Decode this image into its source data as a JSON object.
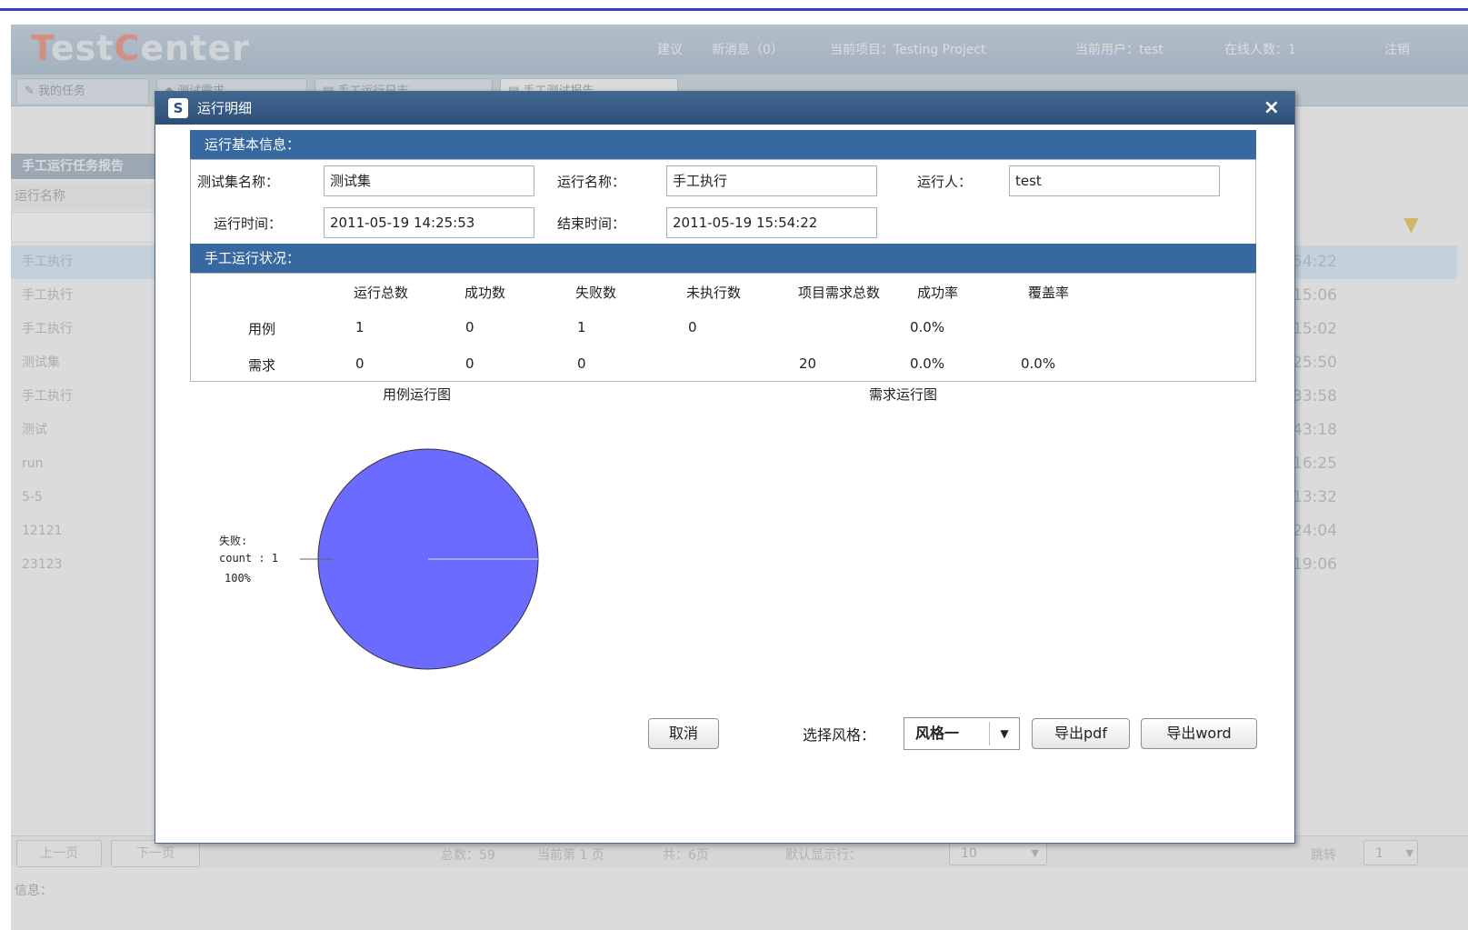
{
  "app": {
    "logo_t": "T",
    "logo_est": "est",
    "logo_c": "C",
    "logo_enter": "enter",
    "header_links": [
      "建议",
      "新消息（0）",
      "当前项目：Testing Project",
      "当前用户：test",
      "在线人数：1",
      "注销"
    ]
  },
  "tabs": [
    "我的任务",
    "测试需求",
    "手工运行日志",
    "手工测试报告"
  ],
  "left_panel": {
    "title": "手工运行任务报告",
    "column": "运行名称",
    "rows": [
      "手工执行",
      "手工执行",
      "手工执行",
      "测试集",
      "手工执行",
      "测试",
      "run",
      "5-5",
      "12121",
      "23123"
    ]
  },
  "right_panel": {
    "rows": [
      "54:22",
      "15:06",
      "15:02",
      "25:50",
      "33:58",
      "43:18",
      "16:25",
      "13:32",
      "24:04",
      "19:06"
    ]
  },
  "footer": {
    "prev": "上一页",
    "next": "下一页",
    "total": "总数：59",
    "current": "当前第 1 页",
    "pages": "共：6页",
    "default_rows_label": "默认显示行：",
    "default_rows_value": "10",
    "jump_label": "跳转",
    "jump_value": "1",
    "info": "信息："
  },
  "dialog": {
    "title": "运行明细",
    "basic_section": "运行基本信息：",
    "fields": {
      "set_name_label": "测试集名称：",
      "set_name_value": "测试集",
      "run_name_label": "运行名称：",
      "run_name_value": "手工执行",
      "runner_label": "运行人：",
      "runner_value": "test",
      "run_time_label": "运行时间：",
      "run_time_value": "2011-05-19 14:25:53",
      "end_time_label": "结束时间：",
      "end_time_value": "2011-05-19 15:54:22"
    },
    "status_section": "手工运行状况：",
    "table": {
      "headers": [
        "运行总数",
        "成功数",
        "失败数",
        "未执行数",
        "项目需求总数",
        "成功率",
        "覆盖率"
      ],
      "rows": [
        {
          "label": "用例",
          "total": "1",
          "success": "0",
          "fail": "1",
          "not_run": "0",
          "req_total": "",
          "success_rate": "0.0%",
          "coverage": ""
        },
        {
          "label": "需求",
          "total": "0",
          "success": "0",
          "fail": "0",
          "not_run": "",
          "req_total": "20",
          "success_rate": "0.0%",
          "coverage": "0.0%"
        }
      ]
    },
    "case_chart_title": "用例运行图",
    "req_chart_title": "需求运行图",
    "chart_data": {
      "type": "pie",
      "title": "用例运行图",
      "slices": [
        {
          "name": "失败",
          "count": 1,
          "percent": 100,
          "color": "#6b6bff"
        }
      ],
      "label_lines": [
        "失败:",
        "count : 1",
        "100%"
      ]
    },
    "buttons": {
      "cancel": "取消",
      "style_label": "选择风格：",
      "style_value": "风格一",
      "export_pdf": "导出pdf",
      "export_word": "导出word"
    }
  }
}
